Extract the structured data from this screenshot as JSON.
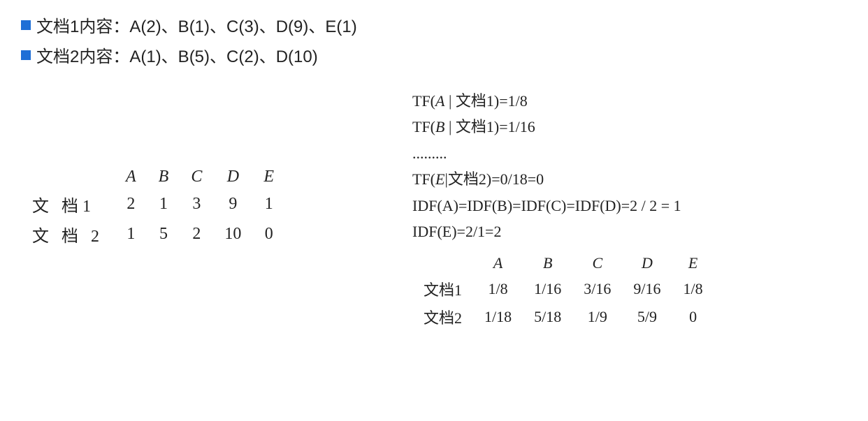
{
  "bullets": {
    "doc1": "文档1内容：A(2)、B(1)、C(3)、D(9)、E(1)",
    "doc2": "文档2内容：A(1)、B(5)、C(2)、D(10)"
  },
  "count_table": {
    "headers": {
      "A": "A",
      "B": "B",
      "C": "C",
      "D": "D",
      "E": "E"
    },
    "rows": {
      "r1": {
        "label": "文 档1",
        "A": "2",
        "B": "1",
        "C": "3",
        "D": "9",
        "E": "1"
      },
      "r2": {
        "label": "文 档 2",
        "A": "1",
        "B": "5",
        "C": "2",
        "D": "10",
        "E": "0"
      }
    }
  },
  "formulas": {
    "pre": "TF(",
    "post": ")=",
    "bar": "|",
    "Aital": "A",
    "Bital": "B",
    "Eital": "E",
    "doc1cjk": "文档1",
    "doc2cjk": "文档2",
    "tfA1_val": "1/8",
    "tfB1_val": "1/16",
    "dots": ".........",
    "tfE2_val": "0/18=0",
    "idfABCD": "IDF(A)=IDF(B)=IDF(C)=IDF(D)=2 / 2 = 1",
    "idfE": "IDF(E)=2/1=2"
  },
  "tfidf_table": {
    "headers": {
      "A": "A",
      "B": "B",
      "C": "C",
      "D": "D",
      "E": "E"
    },
    "rows": {
      "r1": {
        "label": "文档1",
        "A": "1/8",
        "B": "1/16",
        "C": "3/16",
        "D": "9/16",
        "E": "1/8"
      },
      "r2": {
        "label": "文档2",
        "A": "1/18",
        "B": "5/18",
        "C": "1/9",
        "D": "5/9",
        "E": "0"
      }
    }
  }
}
